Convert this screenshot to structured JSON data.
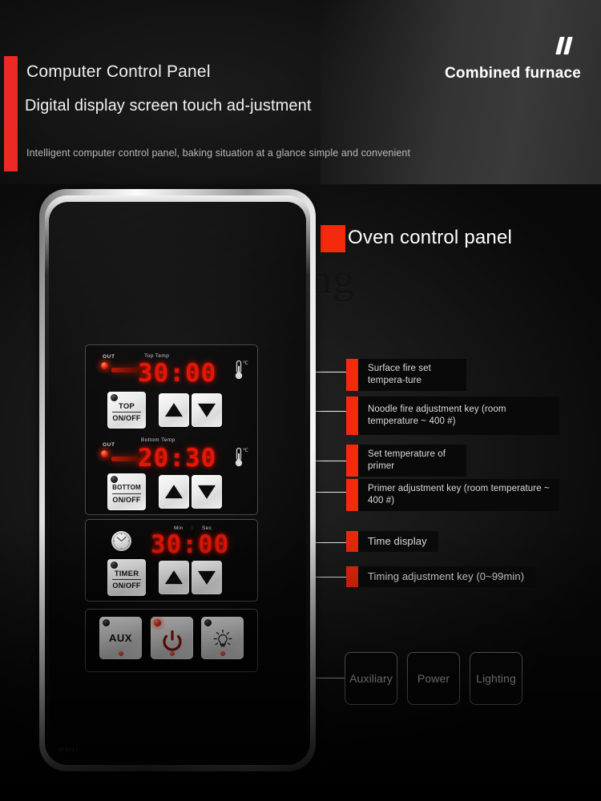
{
  "header": {
    "title": "Computer Control Panel",
    "subtitle": "Digital display screen touch ad-justment",
    "note": "Intelligent computer control panel, baking situation at a glance simple and convenient",
    "brand": "Combined furnace",
    "quote_icon": "double-prime-icon",
    "accent_color": "#ec2a23"
  },
  "body": {
    "watermark": "yicheng",
    "section_title": "Oven control panel",
    "section_marker_color": "#f42a0d"
  },
  "panel": {
    "model_number": "HFS417",
    "top_temp": {
      "out_label": "OUT",
      "caption": "Top Temp",
      "value": "30:00",
      "unit": "℃",
      "thermometer_icon": "thermometer-icon",
      "out_led": "red-led-indicator"
    },
    "top_keys": {
      "onoff_top_label": "TOP",
      "onoff_bottom_label": "ON/OFF",
      "up_icon": "triangle-up-icon",
      "down_icon": "triangle-down-icon",
      "led": "black-led-indicator"
    },
    "bottom_temp": {
      "out_label": "OUT",
      "caption": "Bottom Temp",
      "value": "20:30",
      "unit": "℃",
      "thermometer_icon": "thermometer-icon",
      "out_led": "red-led-indicator"
    },
    "bottom_keys": {
      "onoff_top_label": "BOTTOM",
      "onoff_bottom_label": "ON/OFF",
      "up_icon": "triangle-up-icon",
      "down_icon": "triangle-down-icon",
      "led": "black-led-indicator"
    },
    "timer": {
      "clock_icon": "clock-icon",
      "caption_min": "Min",
      "caption_colon": ":",
      "caption_sec": "Sec",
      "value": "30:00",
      "onoff_top_label": "TIMER",
      "onoff_bottom_label": "ON/OFF",
      "up_icon": "triangle-up-icon",
      "down_icon": "triangle-down-icon",
      "led": "black-led-indicator"
    },
    "function_buttons": [
      {
        "face": "AUX",
        "cap_label": "",
        "led": "black-led-indicator",
        "icon": ""
      },
      {
        "face": "",
        "cap_label": "Power",
        "led": "red-led-indicator",
        "icon": "power-icon"
      },
      {
        "face": "",
        "cap_label": "Light",
        "led": "black-led-indicator",
        "icon": "lightbulb-icon"
      }
    ]
  },
  "annotations": [
    {
      "text": "Surface fire set tempera-ture"
    },
    {
      "text": "Noodle fire adjustment key (room temperature ~ 400 #)"
    },
    {
      "text": "Set temperature of primer"
    },
    {
      "text": "Primer adjustment key (room temperature ~ 400 #)"
    }
  ],
  "annotations2": [
    {
      "text": "Time display"
    },
    {
      "text": "Timing adjustment key (0~99min)"
    }
  ],
  "outline_boxes": [
    {
      "label": "Auxiliary"
    },
    {
      "label": "Power"
    },
    {
      "label": "Lighting"
    }
  ]
}
